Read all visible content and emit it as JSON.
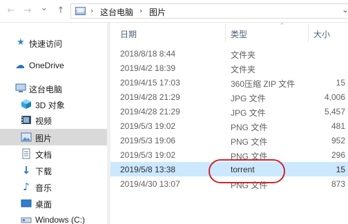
{
  "nav": {
    "back_glyph": "←",
    "forward_glyph": "→",
    "recent_glyph": "⌄",
    "up_glyph": "↑"
  },
  "address": {
    "separator": "›",
    "breadcrumbs": [
      "这台电脑",
      "图片"
    ],
    "dropdown_glyph": "⌄"
  },
  "sidebar": {
    "items": [
      {
        "label": "快速访问",
        "icon": "pin-icon",
        "glyph": "★"
      },
      {
        "label": "OneDrive",
        "icon": "cloud-icon",
        "glyph": "☁"
      },
      {
        "label": "这台电脑",
        "icon": "computer-icon",
        "glyph": ""
      },
      {
        "label": "3D 对象",
        "icon": "cube-icon",
        "glyph": ""
      },
      {
        "label": "视频",
        "icon": "video-icon",
        "glyph": ""
      },
      {
        "label": "图片",
        "icon": "pictures-icon",
        "glyph": ""
      },
      {
        "label": "文档",
        "icon": "document-icon",
        "glyph": ""
      },
      {
        "label": "下载",
        "icon": "download-icon",
        "glyph": "↓"
      },
      {
        "label": "音乐",
        "icon": "music-icon",
        "glyph": "♪"
      },
      {
        "label": "桌面",
        "icon": "desktop-icon",
        "glyph": ""
      },
      {
        "label": "Windows (C:)",
        "icon": "drive-icon",
        "glyph": ""
      }
    ],
    "selected_index": 5
  },
  "columns": {
    "date": "日期",
    "type": "类型",
    "size": "大小",
    "sort_glyph": "^"
  },
  "files": [
    {
      "date": "2018/8/18 8:44",
      "type": "文件夹",
      "size": ""
    },
    {
      "date": "2019/4/2 18:39",
      "type": "文件夹",
      "size": ""
    },
    {
      "date": "2019/4/15 17:03",
      "type": "360压缩 ZIP 文件",
      "size": "15"
    },
    {
      "date": "2019/4/28 21:29",
      "type": "JPG 文件",
      "size": "4,006"
    },
    {
      "date": "2019/4/28 21:29",
      "type": "JPG 文件",
      "size": "5,457"
    },
    {
      "date": "2019/5/3 19:02",
      "type": "PNG 文件",
      "size": "481"
    },
    {
      "date": "2019/5/3 19:06",
      "type": "PNG 文件",
      "size": "952"
    },
    {
      "date": "2019/5/3 19:02",
      "type": "PNG 文件",
      "size": "296"
    },
    {
      "date": "2019/5/8 13:38",
      "type": "torrent",
      "size": "15"
    },
    {
      "date": "2019/4/30 13:07",
      "type": "PNG 文件",
      "size": "873"
    }
  ],
  "selected_file_index": 8,
  "colors": {
    "selection": "#cce8ff",
    "sidebar_selected": "#d9d9d9",
    "annotation": "#d0232b",
    "header_text": "#4c607a"
  }
}
